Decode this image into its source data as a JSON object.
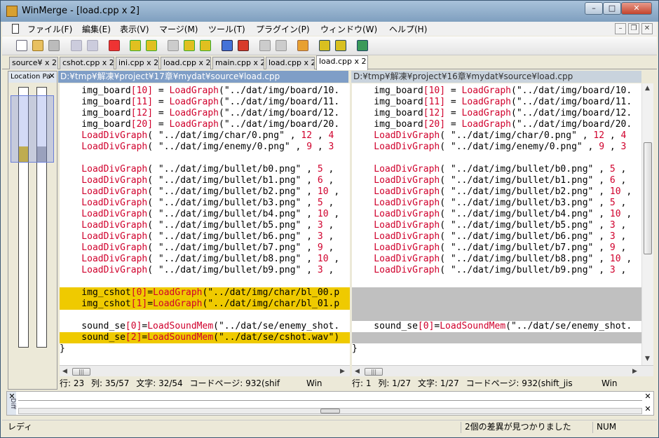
{
  "window": {
    "title": "WinMerge - [load.cpp x 2]"
  },
  "caption_buttons": {
    "minimize": "–",
    "maximize": "□",
    "close": "✕"
  },
  "menu": [
    "ファイル(F)",
    "編集(E)",
    "表示(V)",
    "マージ(M)",
    "ツール(T)",
    "プラグイン(P)",
    "ウィンドウ(W)",
    "ヘルプ(H)"
  ],
  "mdi_buttons": {
    "minimize": "–",
    "restore": "❐",
    "close": "✕"
  },
  "toolbar_icons": [
    "new-file-icon",
    "open-folder-icon",
    "save-icon",
    "undo-icon",
    "redo-icon",
    "option-icon",
    "next-diff-icon",
    "prev-diff-icon",
    "first-diff-icon",
    "current-diff-icon",
    "last-diff-icon",
    "copy-right-icon",
    "copy-left-icon",
    "copy-right-advance-icon",
    "copy-left-advance-icon",
    "all-right-icon",
    "all-left-icon",
    "edit-icon",
    "merge-right-icon",
    "merge-left-icon",
    "refresh-icon"
  ],
  "tabs": [
    "source¥ x 2",
    "cshot.cpp x 2",
    "ini.cpp x 2",
    "load.cpp x 2",
    "main.cpp x 2",
    "load.cpp x 2",
    "load.cpp x 2"
  ],
  "active_tab": 6,
  "location_pane": {
    "title": "Location Pa",
    "close": "✕"
  },
  "left_pane": {
    "path": "D:¥tmp¥解凍¥project¥17章¥mydat¥source¥load.cpp",
    "status": {
      "line": "行: 23",
      "col": "列: 35/57",
      "chars": "文字: 32/54",
      "codepage": "コードページ: 932(shif",
      "eol": "Win"
    }
  },
  "right_pane": {
    "path": "D:¥tmp¥解凍¥project¥16章¥mydat¥source¥load.cpp",
    "status": {
      "line": "行: 1",
      "col": "列: 1/27",
      "chars": "文字: 1/27",
      "codepage": "コードページ: 932(shift_jis",
      "eol": "Win"
    }
  },
  "code_left": [
    {
      "t": "n",
      "parts": [
        [
          "",
          "    img_board"
        ],
        [
          "b",
          "[10]"
        ],
        [
          "",
          " = "
        ],
        [
          "f",
          "LoadGraph"
        ],
        [
          "",
          "(\"../dat/img/board/10."
        ]
      ]
    },
    {
      "t": "n",
      "parts": [
        [
          "",
          "    img_board"
        ],
        [
          "b",
          "[11]"
        ],
        [
          "",
          " = "
        ],
        [
          "f",
          "LoadGraph"
        ],
        [
          "",
          "(\"../dat/img/board/11."
        ]
      ]
    },
    {
      "t": "n",
      "parts": [
        [
          "",
          "    img_board"
        ],
        [
          "b",
          "[12]"
        ],
        [
          "",
          " = "
        ],
        [
          "f",
          "LoadGraph"
        ],
        [
          "",
          "(\"../dat/img/board/12."
        ]
      ]
    },
    {
      "t": "n",
      "parts": [
        [
          "",
          "    img_board"
        ],
        [
          "b",
          "[20]"
        ],
        [
          "",
          " = "
        ],
        [
          "f",
          "LoadGraph"
        ],
        [
          "",
          "(\"../dat/img/board/20."
        ]
      ]
    },
    {
      "t": "n",
      "parts": [
        [
          "f",
          "    LoadDivGraph"
        ],
        [
          "",
          "( \"../dat/img/char/0.png\" , "
        ],
        [
          "f",
          "12"
        ],
        [
          "",
          " , "
        ],
        [
          "f",
          "4"
        ]
      ]
    },
    {
      "t": "n",
      "parts": [
        [
          "f",
          "    LoadDivGraph"
        ],
        [
          "",
          "( \"../dat/img/enemy/0.png\" , "
        ],
        [
          "f",
          "9"
        ],
        [
          "",
          " , "
        ],
        [
          "f",
          "3"
        ]
      ]
    },
    {
      "t": "n",
      "parts": []
    },
    {
      "t": "n",
      "parts": [
        [
          "f",
          "    LoadDivGraph"
        ],
        [
          "",
          "( \"../dat/img/bullet/b0.png\" , "
        ],
        [
          "f",
          "5"
        ],
        [
          "",
          " ,"
        ]
      ]
    },
    {
      "t": "n",
      "parts": [
        [
          "f",
          "    LoadDivGraph"
        ],
        [
          "",
          "( \"../dat/img/bullet/b1.png\" , "
        ],
        [
          "f",
          "6"
        ],
        [
          "",
          " ,"
        ]
      ]
    },
    {
      "t": "n",
      "parts": [
        [
          "f",
          "    LoadDivGraph"
        ],
        [
          "",
          "( \"../dat/img/bullet/b2.png\" , "
        ],
        [
          "f",
          "10"
        ],
        [
          "",
          " ,"
        ]
      ]
    },
    {
      "t": "n",
      "parts": [
        [
          "f",
          "    LoadDivGraph"
        ],
        [
          "",
          "( \"../dat/img/bullet/b3.png\" , "
        ],
        [
          "f",
          "5"
        ],
        [
          "",
          " ,"
        ]
      ]
    },
    {
      "t": "n",
      "parts": [
        [
          "f",
          "    LoadDivGraph"
        ],
        [
          "",
          "( \"../dat/img/bullet/b4.png\" , "
        ],
        [
          "f",
          "10"
        ],
        [
          "",
          " ,"
        ]
      ]
    },
    {
      "t": "n",
      "parts": [
        [
          "f",
          "    LoadDivGraph"
        ],
        [
          "",
          "( \"../dat/img/bullet/b5.png\" , "
        ],
        [
          "f",
          "3"
        ],
        [
          "",
          " ,"
        ]
      ]
    },
    {
      "t": "n",
      "parts": [
        [
          "f",
          "    LoadDivGraph"
        ],
        [
          "",
          "( \"../dat/img/bullet/b6.png\" , "
        ],
        [
          "f",
          "3"
        ],
        [
          "",
          " ,"
        ]
      ]
    },
    {
      "t": "n",
      "parts": [
        [
          "f",
          "    LoadDivGraph"
        ],
        [
          "",
          "( \"../dat/img/bullet/b7.png\" , "
        ],
        [
          "f",
          "9"
        ],
        [
          "",
          " ,"
        ]
      ]
    },
    {
      "t": "n",
      "parts": [
        [
          "f",
          "    LoadDivGraph"
        ],
        [
          "",
          "( \"../dat/img/bullet/b8.png\" , "
        ],
        [
          "f",
          "10"
        ],
        [
          "",
          " ,"
        ]
      ]
    },
    {
      "t": "n",
      "parts": [
        [
          "f",
          "    LoadDivGraph"
        ],
        [
          "",
          "( \"../dat/img/bullet/b9.png\" , "
        ],
        [
          "f",
          "3"
        ],
        [
          "",
          " ,"
        ]
      ]
    },
    {
      "t": "n",
      "parts": []
    },
    {
      "t": "d",
      "parts": [
        [
          "",
          "    img_cshot"
        ],
        [
          "b",
          "[0]"
        ],
        [
          "",
          "="
        ],
        [
          "f",
          "LoadGraph"
        ],
        [
          "",
          "(\"../dat/img/char/bl_00.p"
        ]
      ]
    },
    {
      "t": "d",
      "parts": [
        [
          "",
          "    img_cshot"
        ],
        [
          "b",
          "[1]"
        ],
        [
          "",
          "="
        ],
        [
          "f",
          "LoadGraph"
        ],
        [
          "",
          "(\"../dat/img/char/bl_01.p"
        ]
      ]
    },
    {
      "t": "n",
      "parts": []
    },
    {
      "t": "n",
      "parts": [
        [
          "",
          "    sound_se"
        ],
        [
          "b",
          "[0]"
        ],
        [
          "",
          "="
        ],
        [
          "f",
          "LoadSoundMem"
        ],
        [
          "",
          "(\"../dat/se/enemy_shot."
        ]
      ]
    },
    {
      "t": "d",
      "parts": [
        [
          "",
          "    sound_se"
        ],
        [
          "b",
          "[2]"
        ],
        [
          "",
          "="
        ],
        [
          "f",
          "LoadSoundMem"
        ],
        [
          "",
          "(\"../dat/se/cshot.wav\")"
        ]
      ]
    },
    {
      "t": "n",
      "parts": [
        [
          "",
          "}"
        ]
      ]
    }
  ],
  "code_right": [
    {
      "t": "n",
      "parts": [
        [
          "",
          "    img_board"
        ],
        [
          "b",
          "[10]"
        ],
        [
          "",
          " = "
        ],
        [
          "f",
          "LoadGraph"
        ],
        [
          "",
          "(\"../dat/img/board/10."
        ]
      ]
    },
    {
      "t": "n",
      "parts": [
        [
          "",
          "    img_board"
        ],
        [
          "b",
          "[11]"
        ],
        [
          "",
          " = "
        ],
        [
          "f",
          "LoadGraph"
        ],
        [
          "",
          "(\"../dat/img/board/11."
        ]
      ]
    },
    {
      "t": "n",
      "parts": [
        [
          "",
          "    img_board"
        ],
        [
          "b",
          "[12]"
        ],
        [
          "",
          " = "
        ],
        [
          "f",
          "LoadGraph"
        ],
        [
          "",
          "(\"../dat/img/board/12."
        ]
      ]
    },
    {
      "t": "n",
      "parts": [
        [
          "",
          "    img_board"
        ],
        [
          "b",
          "[20]"
        ],
        [
          "",
          " = "
        ],
        [
          "f",
          "LoadGraph"
        ],
        [
          "",
          "(\"../dat/img/board/20."
        ]
      ]
    },
    {
      "t": "n",
      "parts": [
        [
          "f",
          "    LoadDivGraph"
        ],
        [
          "",
          "( \"../dat/img/char/0.png\" , "
        ],
        [
          "f",
          "12"
        ],
        [
          "",
          " , "
        ],
        [
          "f",
          "4"
        ]
      ]
    },
    {
      "t": "n",
      "parts": [
        [
          "f",
          "    LoadDivGraph"
        ],
        [
          "",
          "( \"../dat/img/enemy/0.png\" , "
        ],
        [
          "f",
          "9"
        ],
        [
          "",
          " , "
        ],
        [
          "f",
          "3"
        ]
      ]
    },
    {
      "t": "n",
      "parts": []
    },
    {
      "t": "n",
      "parts": [
        [
          "f",
          "    LoadDivGraph"
        ],
        [
          "",
          "( \"../dat/img/bullet/b0.png\" , "
        ],
        [
          "f",
          "5"
        ],
        [
          "",
          " ,"
        ]
      ]
    },
    {
      "t": "n",
      "parts": [
        [
          "f",
          "    LoadDivGraph"
        ],
        [
          "",
          "( \"../dat/img/bullet/b1.png\" , "
        ],
        [
          "f",
          "6"
        ],
        [
          "",
          " ,"
        ]
      ]
    },
    {
      "t": "n",
      "parts": [
        [
          "f",
          "    LoadDivGraph"
        ],
        [
          "",
          "( \"../dat/img/bullet/b2.png\" , "
        ],
        [
          "f",
          "10"
        ],
        [
          "",
          " ,"
        ]
      ]
    },
    {
      "t": "n",
      "parts": [
        [
          "f",
          "    LoadDivGraph"
        ],
        [
          "",
          "( \"../dat/img/bullet/b3.png\" , "
        ],
        [
          "f",
          "5"
        ],
        [
          "",
          " ,"
        ]
      ]
    },
    {
      "t": "n",
      "parts": [
        [
          "f",
          "    LoadDivGraph"
        ],
        [
          "",
          "( \"../dat/img/bullet/b4.png\" , "
        ],
        [
          "f",
          "10"
        ],
        [
          "",
          " ,"
        ]
      ]
    },
    {
      "t": "n",
      "parts": [
        [
          "f",
          "    LoadDivGraph"
        ],
        [
          "",
          "( \"../dat/img/bullet/b5.png\" , "
        ],
        [
          "f",
          "3"
        ],
        [
          "",
          " ,"
        ]
      ]
    },
    {
      "t": "n",
      "parts": [
        [
          "f",
          "    LoadDivGraph"
        ],
        [
          "",
          "( \"../dat/img/bullet/b6.png\" , "
        ],
        [
          "f",
          "3"
        ],
        [
          "",
          " ,"
        ]
      ]
    },
    {
      "t": "n",
      "parts": [
        [
          "f",
          "    LoadDivGraph"
        ],
        [
          "",
          "( \"../dat/img/bullet/b7.png\" , "
        ],
        [
          "f",
          "9"
        ],
        [
          "",
          " ,"
        ]
      ]
    },
    {
      "t": "n",
      "parts": [
        [
          "f",
          "    LoadDivGraph"
        ],
        [
          "",
          "( \"../dat/img/bullet/b8.png\" , "
        ],
        [
          "f",
          "10"
        ],
        [
          "",
          " ,"
        ]
      ]
    },
    {
      "t": "n",
      "parts": [
        [
          "f",
          "    LoadDivGraph"
        ],
        [
          "",
          "( \"../dat/img/bullet/b9.png\" , "
        ],
        [
          "f",
          "3"
        ],
        [
          "",
          " ,"
        ]
      ]
    },
    {
      "t": "n",
      "parts": []
    },
    {
      "t": "g",
      "parts": []
    },
    {
      "t": "g",
      "parts": []
    },
    {
      "t": "g",
      "parts": []
    },
    {
      "t": "n",
      "parts": [
        [
          "",
          "    sound_se"
        ],
        [
          "b",
          "[0]"
        ],
        [
          "",
          "="
        ],
        [
          "f",
          "LoadSoundMem"
        ],
        [
          "",
          "(\"../dat/se/enemy_shot."
        ]
      ]
    },
    {
      "t": "g",
      "parts": []
    },
    {
      "t": "n",
      "parts": [
        [
          "",
          "}"
        ]
      ]
    }
  ],
  "scrollbar": {
    "thumb_grip": "|||",
    "left_arrow": "◀",
    "right_arrow": "▶",
    "up_arrow": "▲",
    "down_arrow": "▼"
  },
  "diff_pane": {
    "label": "Diff",
    "close": "✕"
  },
  "app_status": {
    "ready": "レディ",
    "differences": "2個の差異が見つかりました",
    "num": "NUM"
  },
  "colors": {
    "diff": "#efca00",
    "gap": "#c0c0c0",
    "keyword": "#d0002c",
    "active_header": "#7f9ec7",
    "inactive_header": "#c9d3dd"
  }
}
